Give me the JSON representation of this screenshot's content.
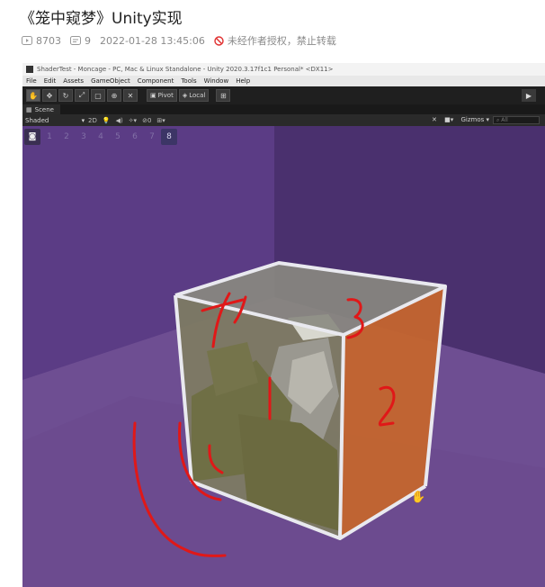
{
  "post": {
    "title": "《笼中窥梦》Unity实现",
    "views": "8703",
    "comments": "9",
    "date": "2022-01-28 13:45:06",
    "rights": "未经作者授权，禁止转载"
  },
  "unity": {
    "window_title": "ShaderTest - Moncage - PC, Mac & Linux Standalone - Unity 2020.3.17f1c1 Personal* <DX11>",
    "menu": [
      "File",
      "Edit",
      "Assets",
      "GameObject",
      "Component",
      "Tools",
      "Window",
      "Help"
    ],
    "pivot_label": "Pivot",
    "local_label": "Local",
    "scene_tab": "Scene",
    "shading_mode": "Shaded",
    "mode_2d": "2D",
    "hidden_count": "0",
    "gizmos_label": "Gizmos",
    "search_placeholder": "All",
    "layer_buttons": [
      "1",
      "2",
      "3",
      "4",
      "5",
      "6",
      "7",
      "8"
    ]
  },
  "annotations": [
    "4",
    "3",
    "1",
    "2"
  ],
  "colors": {
    "background_purple": "#5e3f85",
    "floor_purple": "#6e4e92",
    "orange_face": "#c4652e",
    "olive_face": "#6f6f45",
    "red_ink": "#e01818"
  }
}
